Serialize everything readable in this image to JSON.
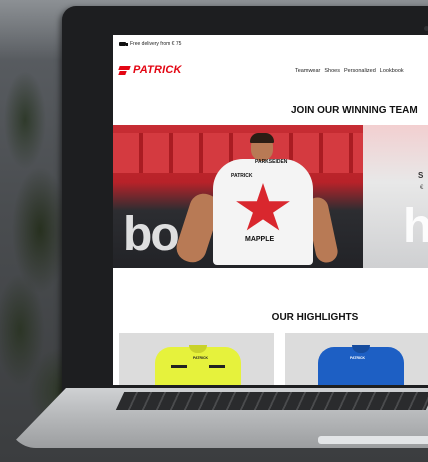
{
  "topbar": {
    "delivery_text": "Free delivery from € 75"
  },
  "brand": {
    "name": "PATRICK",
    "color": "#e30613"
  },
  "nav": {
    "items": [
      "Teamwear",
      "Shoes",
      "Personalized",
      "Lookbook"
    ]
  },
  "hero": {
    "title": "JOIN OUR WINNING TEAM",
    "sponsor_top": "PARKSEIDEN",
    "sponsor_logo": "PATRICK",
    "sponsor_main": "MAPPLE",
    "banner_text": "bo",
    "side_text_1": "S",
    "side_text_2": "€",
    "side_banner": "h"
  },
  "highlights": {
    "title": "OUR HIGHLIGHTS",
    "products": [
      {
        "color": "#e6f23c",
        "logo": "PATRICK"
      },
      {
        "color": "#1d5fc4",
        "logo": "PATRICK"
      }
    ]
  }
}
